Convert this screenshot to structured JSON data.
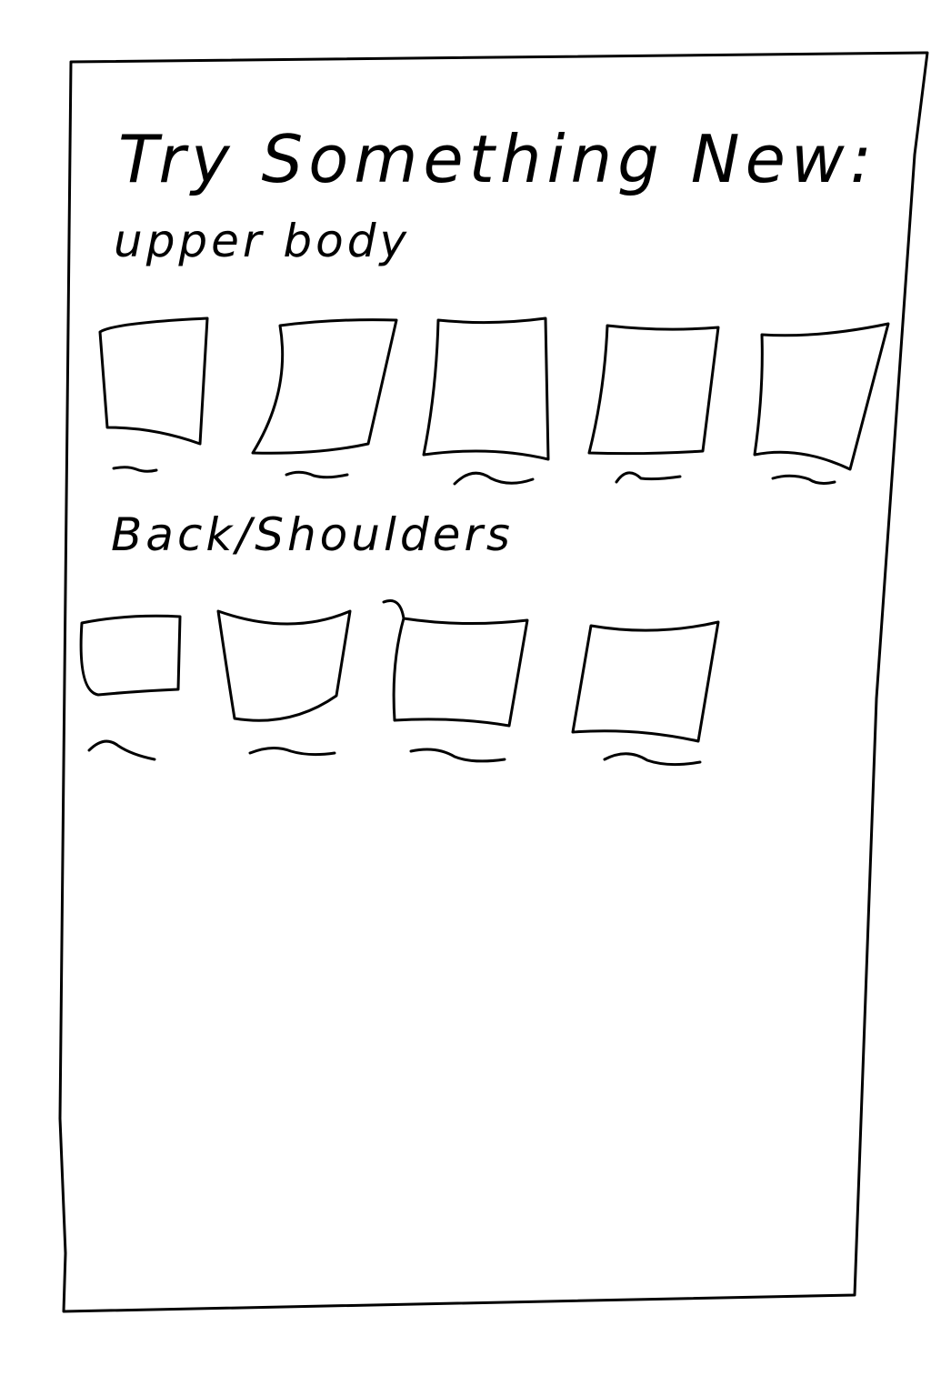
{
  "page": {
    "title": "Try Something New:"
  },
  "sections": [
    {
      "heading": "upper body",
      "card_count": 5
    },
    {
      "heading": "Back/Shoulders",
      "card_count": 4
    }
  ]
}
